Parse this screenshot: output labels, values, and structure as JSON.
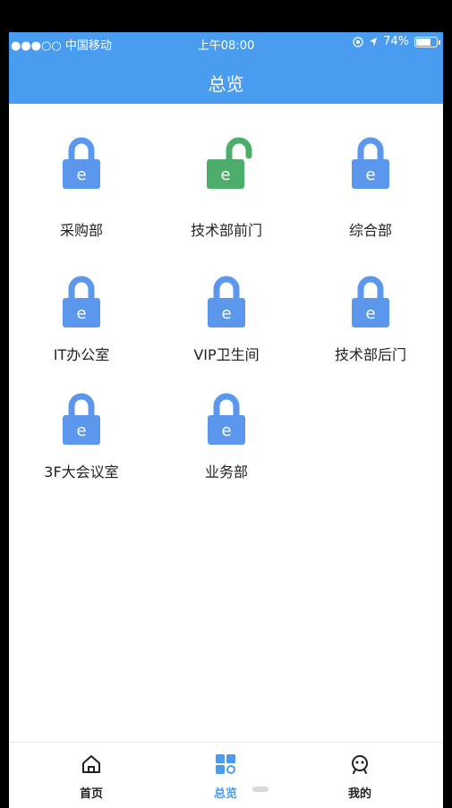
{
  "status_bar": {
    "carrier": "●●●○○ 中国移动",
    "time": "上午08:00",
    "battery_text": "74%",
    "battery_level": 0.74
  },
  "header": {
    "title": "总览"
  },
  "doors": [
    {
      "name": "采购部",
      "status": "locked",
      "icon": "lock-icon"
    },
    {
      "name": "技术部前门",
      "status": "unlocked",
      "icon": "unlock-icon"
    },
    {
      "name": "综合部",
      "status": "locked",
      "icon": "lock-icon"
    },
    {
      "name": "IT办公室",
      "status": "locked",
      "icon": "lock-icon"
    },
    {
      "name": "VIP卫生间",
      "status": "locked",
      "icon": "lock-icon"
    },
    {
      "name": "技术部后门",
      "status": "locked",
      "icon": "lock-icon"
    },
    {
      "name": "3F大会议室",
      "status": "locked",
      "icon": "lock-icon"
    },
    {
      "name": "业务部",
      "status": "locked",
      "icon": "lock-icon"
    }
  ],
  "lock_glyph": "e",
  "colors": {
    "accent": "#4a9cf1",
    "locked": "#5b97ec",
    "unlocked": "#4cae6a",
    "active_tab": "#4a9cf1"
  },
  "tabbar": {
    "tabs": [
      {
        "label": "首页",
        "icon": "home-icon",
        "active": false
      },
      {
        "label": "总览",
        "icon": "grid-icon",
        "active": true
      },
      {
        "label": "我的",
        "icon": "profile-icon",
        "active": false
      }
    ]
  }
}
